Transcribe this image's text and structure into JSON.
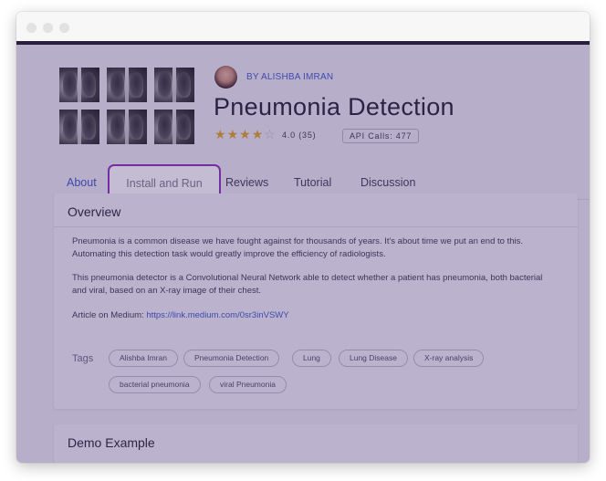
{
  "author": {
    "label": "BY ALISHBA IMRAN"
  },
  "model": {
    "title": "Pneumonia Detection",
    "rating": "4.0 (35)",
    "stars_filled": 4,
    "stars_total": 5,
    "api_calls": "API Calls: 477"
  },
  "tabs": [
    {
      "label": "About"
    },
    {
      "label": "Install and Run"
    },
    {
      "label": "Reviews"
    },
    {
      "label": "Tutorial"
    },
    {
      "label": "Discussion"
    }
  ],
  "overview": {
    "heading": "Overview",
    "paragraph1": "Pneumonia is a common disease we have fought against for thousands of years. It's about time we put an end to this. Automating this detection task would greatly improve the efficiency of radiologists.",
    "paragraph2": "This pneumonia detector is a Convolutional Neural Network able to detect whether a patient has pneumonia, both bacterial and viral, based on an X-ray image of their chest.",
    "article_label": "Article on Medium: ",
    "article_link": "https://link.medium.com/0sr3inVSWY",
    "tags_label": "Tags",
    "tags": [
      "Alishba Imran",
      "Pneumonia Detection",
      "Lung",
      "Lung Disease",
      "X-ray analysis",
      "bacterial pneumonia",
      "viral Pneumonia"
    ]
  },
  "demo": {
    "heading": "Demo Example"
  },
  "colors": {
    "accent": "#3a52c4",
    "highlight": "#8a2bb8",
    "star": "#e0a11b"
  }
}
